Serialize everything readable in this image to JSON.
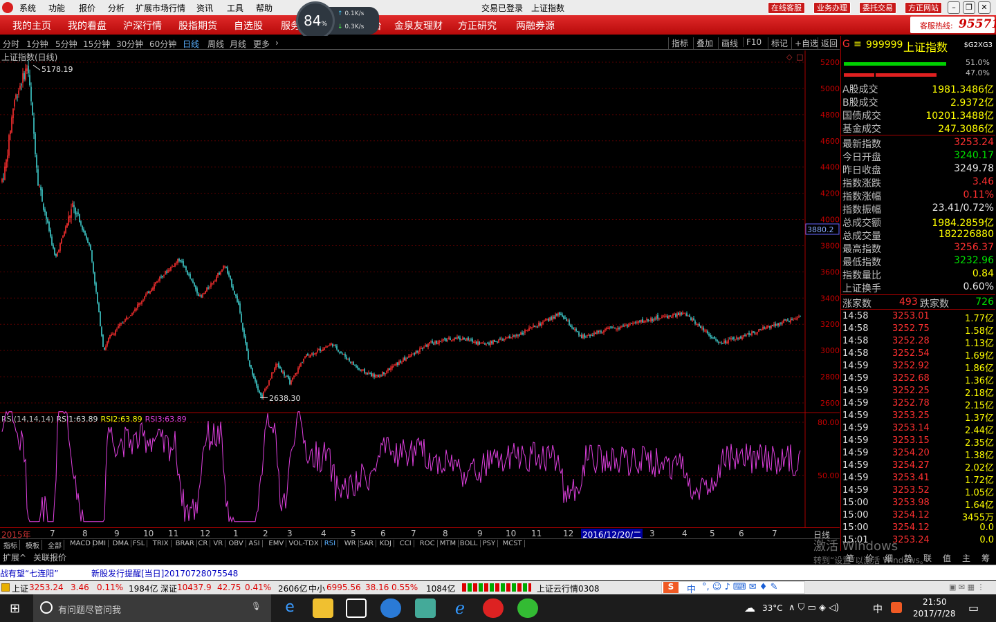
{
  "menu": {
    "items": [
      "系统",
      "功能",
      "报价",
      "分析",
      "扩展市场行情",
      "资讯",
      "工具",
      "帮助"
    ],
    "center": [
      "交易已登录",
      "上证指数"
    ],
    "buttons": [
      "在线客服",
      "业务办理",
      "委托交易",
      "方正网站"
    ]
  },
  "speed": {
    "percent": "84",
    "unit": "%",
    "up": "0.1",
    "down": "0.3",
    "unit_rate": "K/s"
  },
  "nav": {
    "items": [
      "我的主页",
      "我的看盘",
      "沪深行情",
      "股指期货",
      "自选股",
      "服务",
      "台",
      "金泉友理财",
      "方正研究",
      "两融券源"
    ],
    "hotline_label": "客服热线:",
    "hotline": "95571"
  },
  "period": {
    "items": [
      "分时",
      "1分钟",
      "5分钟",
      "15分钟",
      "30分钟",
      "60分钟",
      "日线",
      "周线",
      "月线",
      "更多"
    ],
    "tools": [
      "指标",
      "叠加",
      "画线",
      "F10",
      "标记",
      "+自选",
      "返回"
    ]
  },
  "main_chart": {
    "title": "上证指数(日线)",
    "high_label": "5178.19",
    "low_label": "2638.30",
    "cursor_price": "3880.2",
    "yticks": [
      "5200",
      "5000",
      "4800",
      "4600",
      "4400",
      "4200",
      "4000",
      "3800",
      "3600",
      "3400",
      "3200",
      "3000",
      "2800",
      "2600"
    ]
  },
  "rsi": {
    "label": "RSI(14,14,14)",
    "r1_label": "RSI1:",
    "r1": "63.89",
    "r2_label": "RSI2:",
    "r2": "63.89",
    "r3_label": "RSI3:",
    "r3": "63.89",
    "yticks": [
      "80.00",
      "50.00"
    ]
  },
  "xaxis": {
    "labels": [
      "2015年",
      "7",
      "8",
      "9",
      "10",
      "11",
      "12",
      "1",
      "2",
      "3",
      "4",
      "5",
      "6",
      "7",
      "8",
      "9",
      "10",
      "11",
      "12",
      "2016/12/20/二",
      "3",
      "4",
      "5",
      "6",
      "7"
    ],
    "right": "日线"
  },
  "chart_data": {
    "type": "candlestick",
    "ylim": [
      2600,
      5200
    ],
    "rsi_ylim": [
      20,
      90
    ],
    "highlights": {
      "high": 5178.19,
      "low": 2638.3
    }
  },
  "indicator_tabs": [
    "指标",
    "模板",
    "全部",
    "MACD",
    "DMI",
    "DMA",
    "FSL",
    "TRIX",
    "BRAR",
    "CR",
    "VR",
    "OBV",
    "ASI",
    "EMV",
    "VOL-TDX",
    "RSI",
    "WR",
    "SAR",
    "KDJ",
    "CCI",
    "ROC",
    "MTM",
    "BOLL",
    "PSY",
    "MCST"
  ],
  "bottom_tabs": [
    "扩展^",
    "关联报价"
  ],
  "quote": {
    "code": "999999",
    "name": "上证指数",
    "tag": "$G2XG3",
    "bar_up": "51.0%",
    "bar_down": "47.0%",
    "rows1": [
      {
        "l": "A股成交",
        "v": "1981.3486亿"
      },
      {
        "l": "B股成交",
        "v": "2.9372亿"
      },
      {
        "l": "国债成交",
        "v": "10201.3488亿"
      },
      {
        "l": "基金成交",
        "v": "247.3086亿"
      }
    ],
    "rows2": [
      {
        "l": "最新指数",
        "v": "3253.24",
        "c": "red"
      },
      {
        "l": "今日开盘",
        "v": "3240.17",
        "c": "grn"
      },
      {
        "l": "昨日收盘",
        "v": "3249.78",
        "c": "wht"
      },
      {
        "l": "指数涨跌",
        "v": "3.46",
        "c": "red"
      },
      {
        "l": "指数涨幅",
        "v": "0.11%",
        "c": "red"
      },
      {
        "l": "指数振幅",
        "v": "23.41/0.72%",
        "c": "wht"
      },
      {
        "l": "总成交额",
        "v": "1984.2859亿",
        "c": "yel"
      },
      {
        "l": "总成交量",
        "v": "182226880",
        "c": "yel"
      },
      {
        "l": "最高指数",
        "v": "3256.37",
        "c": "red"
      },
      {
        "l": "最低指数",
        "v": "3232.96",
        "c": "grn"
      },
      {
        "l": "指数量比",
        "v": "0.84",
        "c": "yel"
      },
      {
        "l": "上证换手",
        "v": "0.60%",
        "c": "wht"
      }
    ],
    "up_label": "涨家数",
    "up": "493",
    "down_label": "跌家数",
    "down": "726",
    "trades": [
      [
        "14:58",
        "3253.01",
        "1.77亿"
      ],
      [
        "14:58",
        "3252.75",
        "1.58亿"
      ],
      [
        "14:58",
        "3252.28",
        "1.13亿"
      ],
      [
        "14:58",
        "3252.54",
        "1.69亿"
      ],
      [
        "14:59",
        "3252.92",
        "1.86亿"
      ],
      [
        "14:59",
        "3252.68",
        "1.36亿"
      ],
      [
        "14:59",
        "3252.25",
        "2.18亿"
      ],
      [
        "14:59",
        "3252.78",
        "2.15亿"
      ],
      [
        "14:59",
        "3253.25",
        "1.37亿"
      ],
      [
        "14:59",
        "3253.14",
        "2.44亿"
      ],
      [
        "14:59",
        "3253.15",
        "2.35亿"
      ],
      [
        "14:59",
        "3254.20",
        "1.38亿"
      ],
      [
        "14:59",
        "3254.27",
        "2.02亿"
      ],
      [
        "14:59",
        "3253.41",
        "1.72亿"
      ],
      [
        "14:59",
        "3253.52",
        "1.05亿"
      ],
      [
        "15:00",
        "3253.98",
        "1.64亿"
      ],
      [
        "15:00",
        "3254.12",
        "3455万"
      ],
      [
        "15:00",
        "3254.12",
        "0.0"
      ],
      [
        "15:01",
        "3253.24",
        "0.0"
      ]
    ],
    "tabs": [
      "笔",
      "价",
      "细",
      "势",
      "联",
      "值",
      "主",
      "筹"
    ]
  },
  "ticker": {
    "a": "战有望“七连阳”",
    "b": "新股发行提醒[当日]20170728075548"
  },
  "status": {
    "sh_label": "上证",
    "sh": "3253.24",
    "sh_chg": "3.46",
    "sh_pct": "0.11%",
    "sh_amt": "1984亿",
    "sz_label": "深证",
    "sz": "10437.9",
    "sz_chg": "42.75",
    "sz_pct": "0.41%",
    "sz_amt": "2606亿",
    "zx_label": "中小",
    "zx": "6995.56",
    "zx_chg": "38.16",
    "zx_pct": "0.55%",
    "zx_amt": "1084亿",
    "cloud": "上证云行情0308",
    "ime": "中"
  },
  "watermark": {
    "line1": "激活 Windows",
    "line2": "转到“设置”以激活 Windows。"
  },
  "taskbar": {
    "search": "有问题尽管问我",
    "weather": "33°C",
    "ime": "中",
    "time": "21:50",
    "date": "2017/7/28"
  }
}
